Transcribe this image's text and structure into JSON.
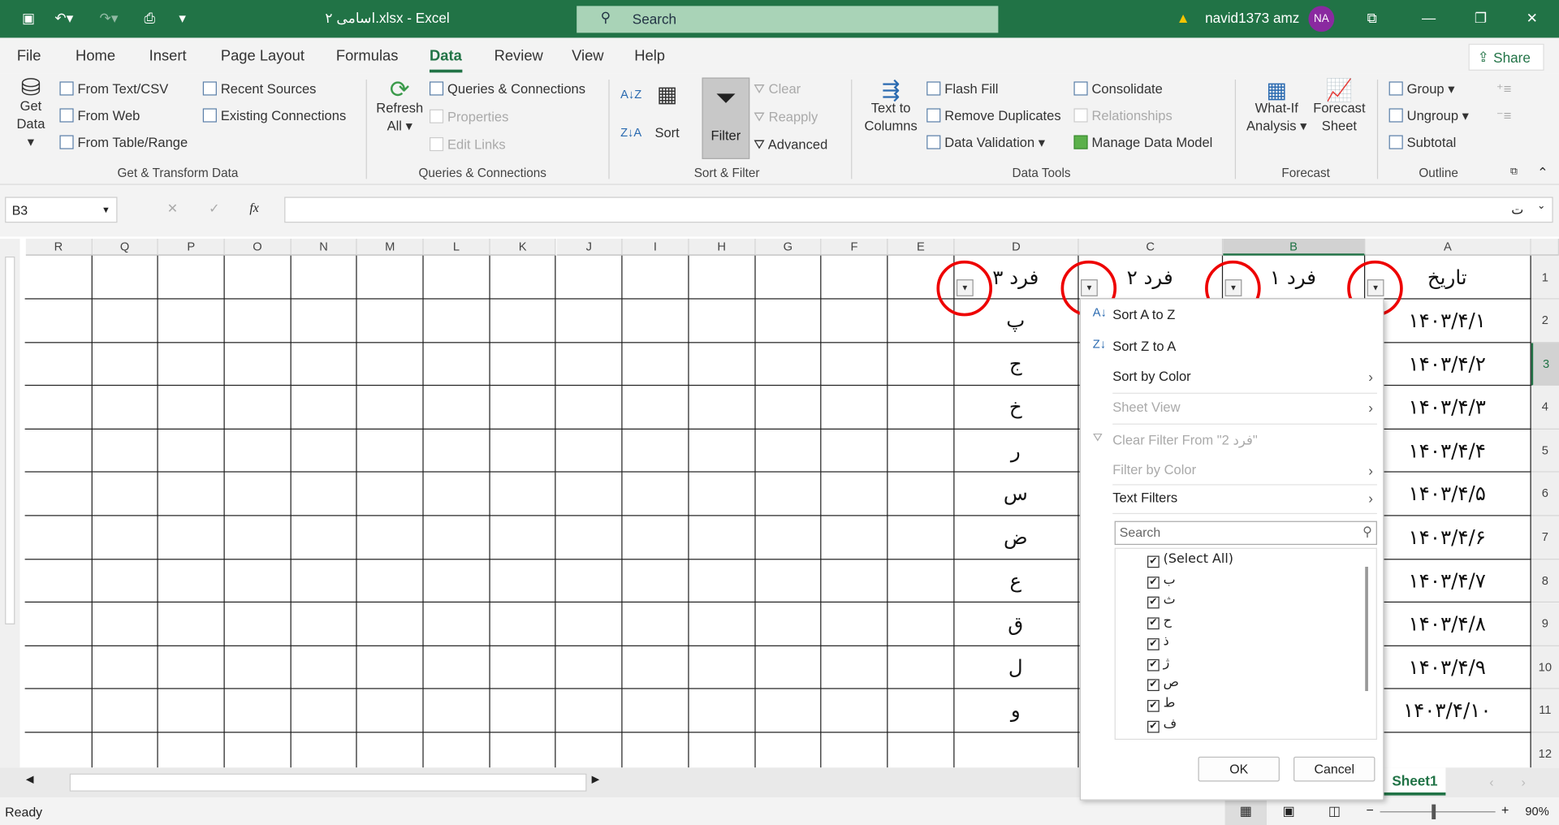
{
  "titlebar": {
    "filename": "اسامی ۲.xlsx",
    "sep": " - ",
    "app": "Excel",
    "search_placeholder": "Search",
    "user": "navid1373 amz",
    "avatar": "NA"
  },
  "tabs": [
    "File",
    "Home",
    "Insert",
    "Page Layout",
    "Formulas",
    "Data",
    "Review",
    "View",
    "Help"
  ],
  "active_tab": "Data",
  "share": "Share",
  "ribbon": {
    "get_data": "Get Data",
    "get_transform": [
      "From Text/CSV",
      "From Web",
      "From Table/Range",
      "Recent Sources",
      "Existing Connections"
    ],
    "refresh": "Refresh All",
    "queries": [
      "Queries & Connections",
      "Properties",
      "Edit Links"
    ],
    "sort": "Sort",
    "filter": "Filter",
    "clear": "Clear",
    "reapply": "Reapply",
    "advanced": "Advanced",
    "text_to_columns": "Text to Columns",
    "data_tools": [
      "Flash Fill",
      "Remove Duplicates",
      "Data Validation",
      "Consolidate",
      "Relationships",
      "Manage Data Model"
    ],
    "what_if": "What-If Analysis",
    "forecast_sheet": "Forecast Sheet",
    "outline": [
      "Group",
      "Ungroup",
      "Subtotal"
    ],
    "groups": [
      "Get & Transform Data",
      "Queries & Connections",
      "Sort & Filter",
      "Data Tools",
      "Forecast",
      "Outline"
    ]
  },
  "namebox": "B3",
  "formula": "",
  "columns": [
    "A",
    "B",
    "C",
    "D",
    "E",
    "F",
    "G",
    "H",
    "I",
    "J",
    "K",
    "L",
    "M",
    "N",
    "O",
    "P",
    "Q",
    "R"
  ],
  "selected_col": "B",
  "selected_row": 3,
  "rows": [
    [
      "تاریخ",
      "فرد ۱",
      "فرد ۲",
      "فرد ۳"
    ],
    [
      "۱۴۰۳/۴/۱",
      "",
      "",
      "پ"
    ],
    [
      "۱۴۰۳/۴/۲",
      "",
      "",
      "ج"
    ],
    [
      "۱۴۰۳/۴/۳",
      "",
      "",
      "خ"
    ],
    [
      "۱۴۰۳/۴/۴",
      "",
      "",
      "ر"
    ],
    [
      "۱۴۰۳/۴/۵",
      "",
      "",
      "س"
    ],
    [
      "۱۴۰۳/۴/۶",
      "",
      "",
      "ض"
    ],
    [
      "۱۴۰۳/۴/۷",
      "",
      "",
      "ع"
    ],
    [
      "۱۴۰۳/۴/۸",
      "",
      "",
      "ق"
    ],
    [
      "۱۴۰۳/۴/۹",
      "",
      "",
      "ل"
    ],
    [
      "۱۴۰۳/۴/۱۰",
      "",
      "",
      "و"
    ],
    [
      "",
      "",
      "",
      ""
    ]
  ],
  "filter_menu": {
    "items": [
      {
        "label": "Sort A to Z",
        "disabled": false
      },
      {
        "label": "Sort Z to A",
        "disabled": false
      },
      {
        "label": "Sort by Color",
        "disabled": false,
        "submenu": true
      },
      {
        "label": "Sheet View",
        "disabled": true,
        "submenu": true
      },
      {
        "label": "Clear Filter From \"فرد 2\"",
        "disabled": true
      },
      {
        "label": "Filter by Color",
        "disabled": true,
        "submenu": true
      },
      {
        "label": "Text Filters",
        "disabled": false,
        "submenu": true
      }
    ],
    "search_placeholder": "Search",
    "values": [
      {
        "label": "(Select All)",
        "checked": true
      },
      {
        "label": "ب",
        "checked": true
      },
      {
        "label": "ث",
        "checked": true
      },
      {
        "label": "ح",
        "checked": true
      },
      {
        "label": "ذ",
        "checked": true
      },
      {
        "label": "ژ",
        "checked": true
      },
      {
        "label": "ص",
        "checked": true
      },
      {
        "label": "ط",
        "checked": true
      },
      {
        "label": "ف",
        "checked": true
      }
    ],
    "ok": "OK",
    "cancel": "Cancel"
  },
  "sheet_tab": "Sheet1",
  "status": {
    "ready": "Ready",
    "zoom": "90%"
  },
  "colors": {
    "accent": "#217346",
    "highlight_circle": "#e00000"
  }
}
